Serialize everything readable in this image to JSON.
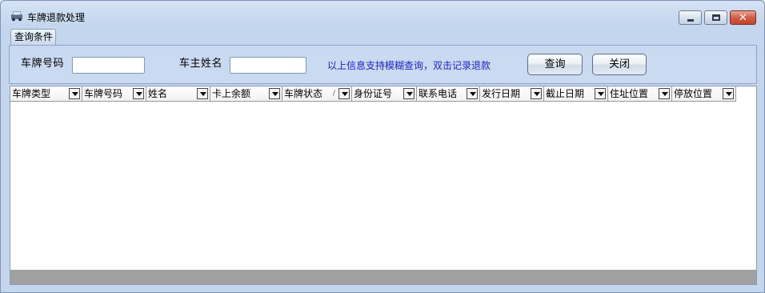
{
  "window": {
    "title": "车牌退款处理",
    "icon": "car-icon"
  },
  "tab": {
    "label": "查询条件"
  },
  "filters": {
    "plate_label": "车牌号码",
    "plate_value": "",
    "owner_label": "车主姓名",
    "owner_value": "",
    "hint": "以上信息支持模糊查询，双击记录退款",
    "query_button": "查询",
    "close_button": "关闭"
  },
  "grid": {
    "columns": [
      {
        "label": "车牌类型"
      },
      {
        "label": "车牌号码"
      },
      {
        "label": "姓名"
      },
      {
        "label": "卡上余额"
      },
      {
        "label": "车牌状态",
        "sort": "/"
      },
      {
        "label": "身份证号"
      },
      {
        "label": "联系电话"
      },
      {
        "label": "发行日期"
      },
      {
        "label": "截止日期"
      },
      {
        "label": "住址位置"
      },
      {
        "label": "停放位置"
      }
    ],
    "rows": []
  }
}
